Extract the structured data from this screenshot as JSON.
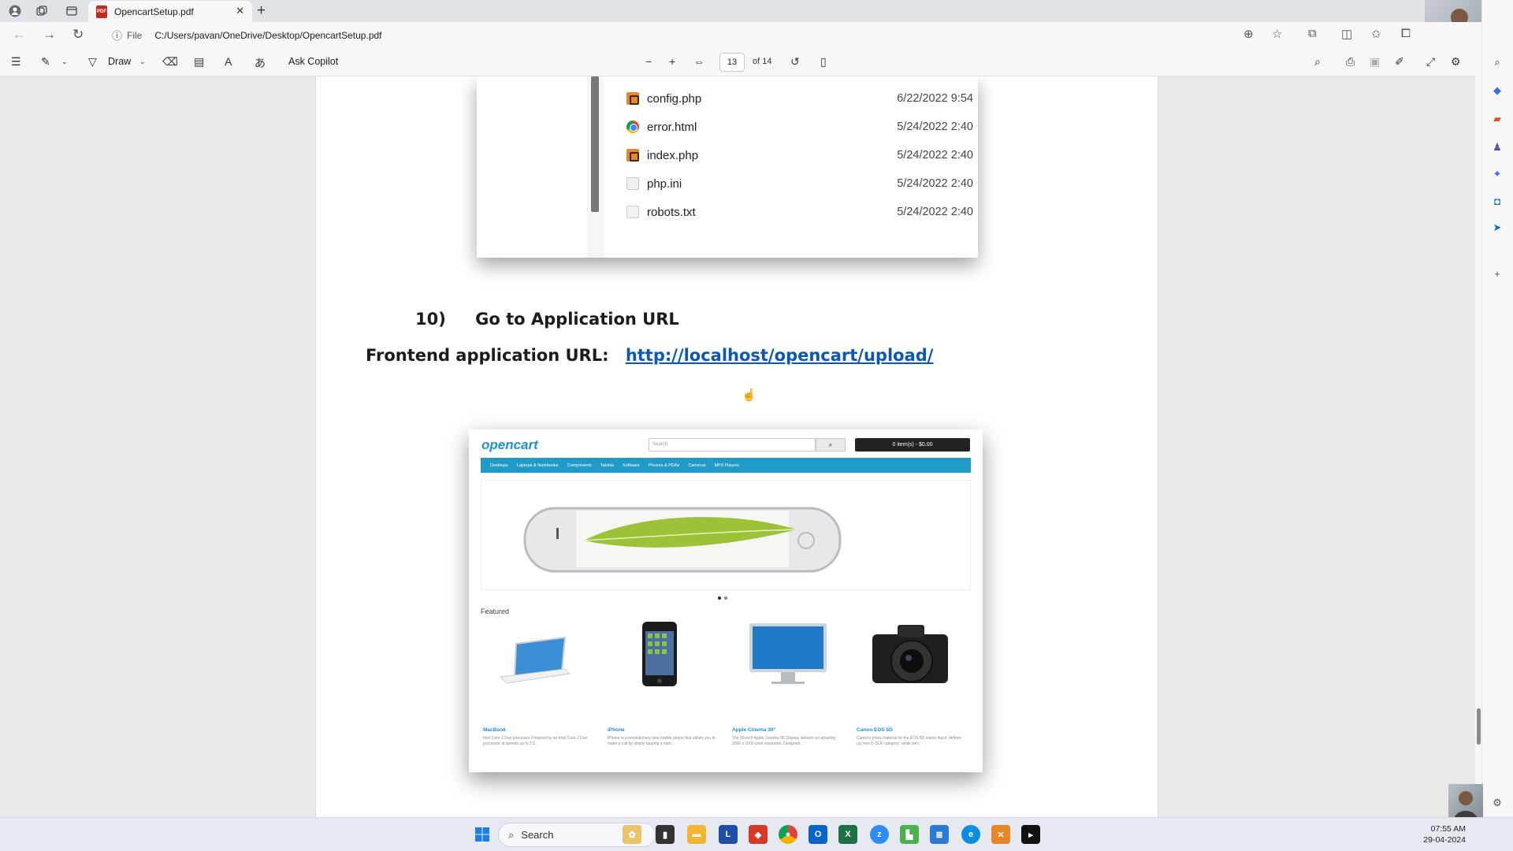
{
  "browser": {
    "tab_title": "OpencartSetup.pdf",
    "tab_close": "✕",
    "new_tab": "+",
    "address_scheme": "File",
    "address_path": "C:/Users/pavan/OneDrive/Desktop/OpencartSetup.pdf"
  },
  "pdf_toolbar": {
    "draw_label": "Draw",
    "ask_copilot_label": "Ask Copilot",
    "page_current": "13",
    "page_total": "of 14"
  },
  "explorer": {
    "files": [
      {
        "name": "config.php",
        "date": "6/22/2022 9:54",
        "icon": "php-file-icon"
      },
      {
        "name": "error.html",
        "date": "5/24/2022 2:40",
        "icon": "chrome-html-icon"
      },
      {
        "name": "index.php",
        "date": "5/24/2022 2:40",
        "icon": "php-file-icon"
      },
      {
        "name": "php.ini",
        "date": "5/24/2022 2:40",
        "icon": "ini-file-icon"
      },
      {
        "name": "robots.txt",
        "date": "5/24/2022 2:40",
        "icon": "text-file-icon"
      }
    ]
  },
  "document": {
    "step_number": "10)",
    "step_title": "Go to Application URL",
    "url_label": "Frontend application URL:",
    "url": "http://localhost/opencart/upload/"
  },
  "opencart": {
    "logo": "opencart",
    "search_placeholder": "Search",
    "cart": "0 item(s) - $0.00",
    "menu": [
      "Desktops",
      "Laptops & Notebooks",
      "Components",
      "Tablets",
      "Software",
      "Phones & PDAs",
      "Cameras",
      "MP3 Players"
    ],
    "featured_label": "Featured",
    "products": [
      {
        "name": "MacBook",
        "desc": "Intel Core 2 Duo processor Powered by an Intel Core 2 Duo processor at speeds up to 2.1.."
      },
      {
        "name": "iPhone",
        "desc": "iPhone is a revolutionary new mobile phone that allows you to make a call by simply tapping a nam.."
      },
      {
        "name": "Apple Cinema 30\"",
        "desc": "The 30-inch Apple Cinema HD Display delivers an amazing 2560 x 1600 pixel resolution. Designed .."
      },
      {
        "name": "Canon EOS 5D",
        "desc": "Canon's press material for the EOS 5D states that it 'defines (a) new D-SLR category', while we'r.."
      }
    ]
  },
  "taskbar": {
    "search_label": "Search",
    "time": "07:55 AM",
    "date": "29-04-2024"
  },
  "colors": {
    "link": "#0a58b3",
    "opencart_blue": "#229ac8",
    "pdf_red": "#c42b1c"
  }
}
